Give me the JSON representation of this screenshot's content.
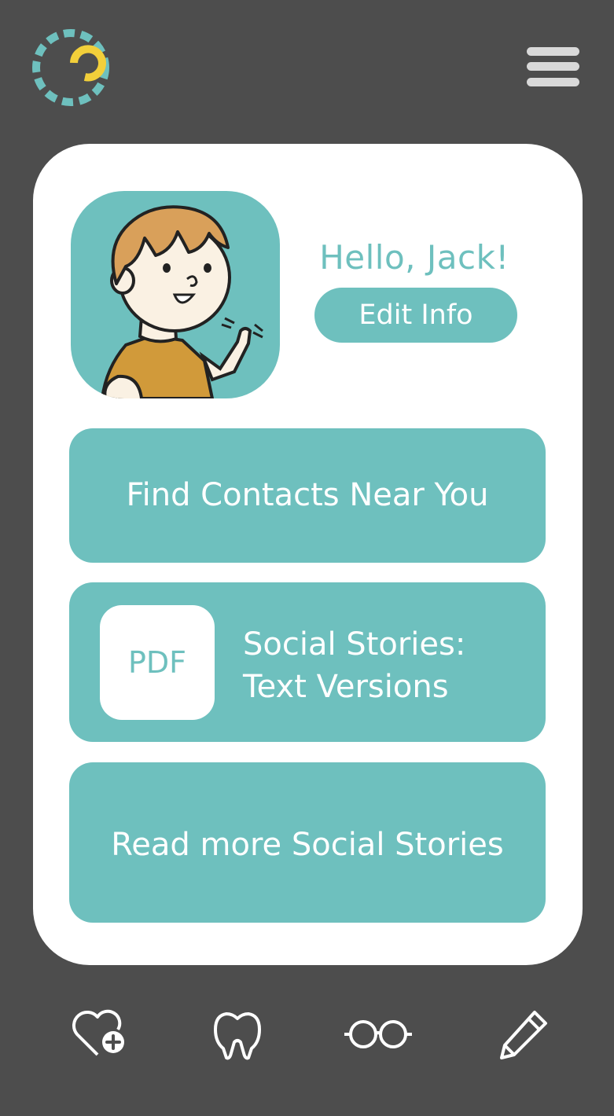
{
  "app": {
    "logo": "loading-ring-logo",
    "menu_icon": "hamburger-menu-icon"
  },
  "profile": {
    "avatar": "waving-boy-avatar",
    "greeting": "Hello, Jack!",
    "edit_label": "Edit Info"
  },
  "actions": {
    "find_contacts": "Find Contacts Near You",
    "pdf_badge": "PDF",
    "pdf_line1": "Social Stories:",
    "pdf_line2": "Text Versions",
    "read_more": "Read more Social Stories"
  },
  "bottom_nav": [
    {
      "icon": "heart-plus-icon"
    },
    {
      "icon": "tooth-icon"
    },
    {
      "icon": "glasses-icon"
    },
    {
      "icon": "pencil-icon"
    }
  ],
  "colors": {
    "background": "#4d4d4d",
    "card": "#ffffff",
    "accent": "#6ec0be",
    "logo_yellow": "#f2cf3a",
    "nav_icon": "#ffffff",
    "menu_icon": "#d9d9d9"
  }
}
